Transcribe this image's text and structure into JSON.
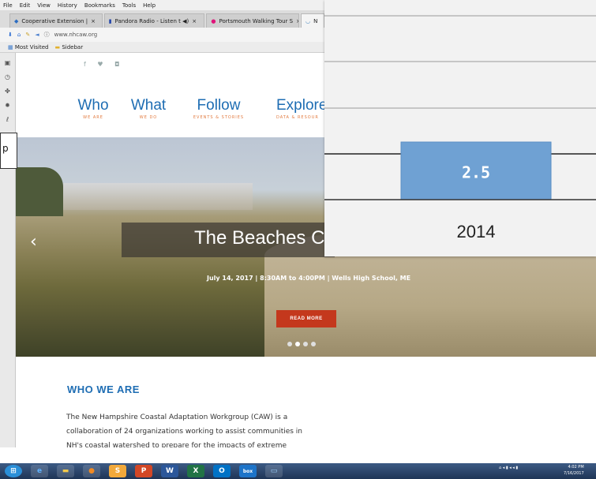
{
  "browser": {
    "menu": [
      "File",
      "Edit",
      "View",
      "History",
      "Bookmarks",
      "Tools",
      "Help"
    ],
    "tabs": [
      {
        "label": "Cooperative Extension |",
        "close": "×",
        "active": false
      },
      {
        "label": "Pandora Radio - Listen t ◀)",
        "close": "×",
        "active": false
      },
      {
        "label": "Portsmouth Walking Tour S",
        "close": "×",
        "active": false
      },
      {
        "label": "N",
        "close": "",
        "active": true
      }
    ],
    "url": "www.nhcaw.org",
    "bookmarks": [
      "Most Visited",
      "Sidebar"
    ]
  },
  "site": {
    "social": "f ♥ ◘",
    "nav": [
      {
        "label": "Who",
        "sub": "WE ARE"
      },
      {
        "label": "What",
        "sub": "WE DO"
      },
      {
        "label": "Follow",
        "sub": "EVENTS & STORIES"
      },
      {
        "label": "Explore",
        "sub": "DATA & RESOUR"
      }
    ],
    "hero": {
      "title": "The Beaches C",
      "subtitle": "July 14, 2017 | 8:30AM to 4:00PM | Wells High School, ME",
      "button": "READ MORE",
      "prev": "‹",
      "slide_index": 2,
      "slide_count": 4
    },
    "who": {
      "heading": "WHO WE ARE",
      "body": "The New Hampshire Coastal Adaptation Workgroup (CAW) is a collaboration of 24 organizations working to assist communities in NH's coastal watershed to prepare for the impacts of extreme weather and long term climate"
    }
  },
  "left_strip_text": "p",
  "taskbar": {
    "icons": [
      "start-orb",
      "ie",
      "explorer",
      "firefox",
      "s",
      "p",
      "w",
      "x",
      "o",
      "box",
      "window"
    ],
    "tray": "⌂ ◂ ▮ ◂ ◂ ▮",
    "time": "4:02 PM",
    "date": "7/16/2017"
  },
  "chart_data": {
    "type": "bar",
    "categories": [
      "2014"
    ],
    "values": [
      2.5
    ],
    "value_labels": [
      "2.5"
    ],
    "bar_color": "#6fa1d3",
    "grid": true
  }
}
